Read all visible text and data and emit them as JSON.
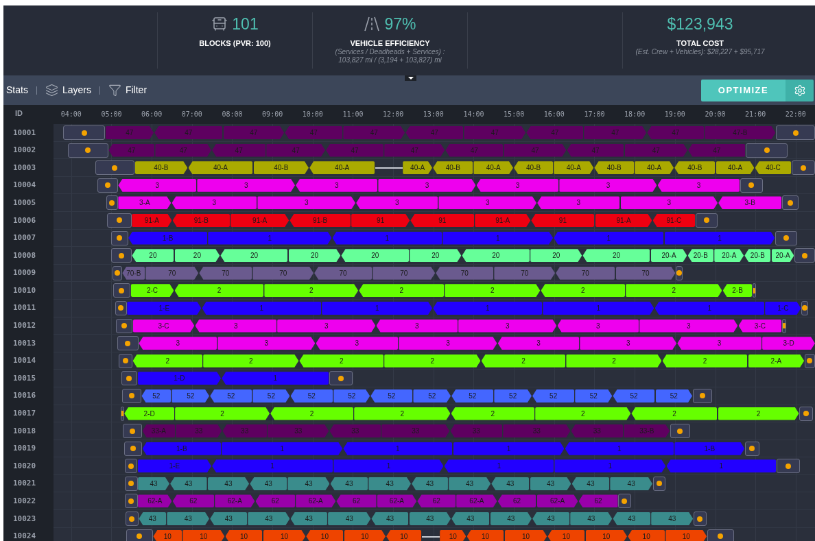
{
  "stats": [
    {
      "kind": "blank"
    },
    {
      "kind": "fleet",
      "value": "101",
      "label": "BLOCKS (PVR: 100)"
    },
    {
      "kind": "road",
      "value": "97%",
      "label": "VEHICLE EFFICIENCY",
      "notes": [
        "(Services / Deadheads + Services) :",
        "103,827 mi / (3,194 + 103,827) mi"
      ]
    },
    {
      "kind": "blank"
    },
    {
      "kind": "plain",
      "value": "$123,943",
      "label": "TOTAL COST",
      "notes": [
        "(Est. Crew + Vehicles): $28,227 + $95,717"
      ]
    }
  ],
  "toolbar": {
    "items": [
      {
        "kind": "text",
        "label": "Stats"
      },
      {
        "kind": "layers",
        "label": "Layers"
      },
      {
        "kind": "filter",
        "label": "Filter"
      }
    ],
    "primary_button": "OPTIMIZE"
  },
  "schedule": {
    "id_header": "ID",
    "times": [
      "04:00",
      "05:00",
      "06:00",
      "07:00",
      "08:00",
      "09:00",
      "10:00",
      "11:00",
      "12:00",
      "13:00",
      "14:00",
      "15:00",
      "16:00",
      "17:00",
      "18:00",
      "19:00",
      "20:00",
      "21:00",
      "22:00"
    ],
    "rows": [
      {
        "id": "10001",
        "color": "#5e0060",
        "trips": [
          {
            "label": "47",
            "kind": "right"
          },
          {
            "label": "47",
            "kind": "left"
          },
          {
            "label": "47",
            "kind": "right"
          },
          {
            "label": "47",
            "kind": "left"
          },
          {
            "label": "47",
            "kind": "right"
          },
          {
            "label": "47",
            "kind": "left"
          },
          {
            "label": "47",
            "kind": "right"
          },
          {
            "label": "47",
            "kind": "left"
          },
          {
            "label": "47",
            "kind": "right"
          },
          {
            "label": "47",
            "kind": "left"
          },
          {
            "label": "47-B",
            "kind": "right"
          }
        ]
      },
      {
        "id": "10002",
        "color": "#5e0060",
        "trips": [
          {
            "label": "47",
            "kind": "left"
          },
          {
            "label": "47",
            "kind": "right"
          },
          {
            "label": "47",
            "kind": "left"
          },
          {
            "label": "47",
            "kind": "right"
          },
          {
            "label": "47",
            "kind": "left"
          },
          {
            "label": "47",
            "kind": "right"
          },
          {
            "label": "47",
            "kind": "left"
          },
          {
            "label": "47",
            "kind": "right"
          },
          {
            "label": "47",
            "kind": "left"
          },
          {
            "label": "47",
            "kind": "right"
          },
          {
            "label": "47",
            "kind": "left"
          }
        ]
      },
      {
        "id": "10003",
        "color": "#aaaa00",
        "trips": [
          {
            "label": "40-B",
            "kind": "right"
          },
          {
            "label": "40-A",
            "kind": "left"
          },
          {
            "label": "40-B",
            "kind": "right"
          },
          {
            "label": "40-A",
            "kind": "left"
          },
          {
            "label": "40-A",
            "kind": "right"
          },
          {
            "label": "40-B",
            "kind": "left"
          },
          {
            "label": "40-A",
            "kind": "right"
          },
          {
            "label": "40-B",
            "kind": "left"
          },
          {
            "label": "40-A",
            "kind": "right"
          },
          {
            "label": "40-B",
            "kind": "left"
          },
          {
            "label": "40-A",
            "kind": "right"
          },
          {
            "label": "40-B",
            "kind": "left"
          },
          {
            "label": "40-A",
            "kind": "right"
          },
          {
            "label": "40-C",
            "kind": "left"
          }
        ]
      },
      {
        "id": "10004",
        "color": "#ee00ee",
        "trips": [
          {
            "label": "3",
            "kind": "left"
          },
          {
            "label": "3",
            "kind": "right"
          },
          {
            "label": "3",
            "kind": "left"
          },
          {
            "label": "3",
            "kind": "right"
          },
          {
            "label": "3",
            "kind": "left"
          },
          {
            "label": "3",
            "kind": "right"
          },
          {
            "label": "3",
            "kind": "left"
          }
        ]
      },
      {
        "id": "10005",
        "color": "#ee00ee",
        "trips": [
          {
            "label": "3-A",
            "kind": "right"
          },
          {
            "label": "3",
            "kind": "left"
          },
          {
            "label": "3",
            "kind": "right"
          },
          {
            "label": "3",
            "kind": "left"
          },
          {
            "label": "3",
            "kind": "right"
          },
          {
            "label": "3",
            "kind": "left"
          },
          {
            "label": "3",
            "kind": "right"
          },
          {
            "label": "3-B",
            "kind": "left"
          }
        ]
      },
      {
        "id": "10006",
        "color": "#ee0011",
        "trips": [
          {
            "label": "91-A",
            "kind": "right"
          },
          {
            "label": "91-B",
            "kind": "left"
          },
          {
            "label": "91-A",
            "kind": "right"
          },
          {
            "label": "91-B",
            "kind": "left"
          },
          {
            "label": "91",
            "kind": "right"
          },
          {
            "label": "91",
            "kind": "left"
          },
          {
            "label": "91-A",
            "kind": "right"
          },
          {
            "label": "91",
            "kind": "left"
          },
          {
            "label": "91-A",
            "kind": "right"
          },
          {
            "label": "91-C",
            "kind": "left"
          }
        ]
      },
      {
        "id": "10007",
        "color": "#2200ff",
        "trips": [
          {
            "label": "1-B",
            "kind": "left"
          },
          {
            "label": "1",
            "kind": "right"
          },
          {
            "label": "1",
            "kind": "left"
          },
          {
            "label": "1",
            "kind": "right"
          },
          {
            "label": "1",
            "kind": "left"
          },
          {
            "label": "1",
            "kind": "right"
          }
        ]
      },
      {
        "id": "10008",
        "color": "#66ff99",
        "trips": [
          {
            "label": "20",
            "kind": "left"
          },
          {
            "label": "20",
            "kind": "right"
          },
          {
            "label": "20",
            "kind": "left"
          },
          {
            "label": "20",
            "kind": "right"
          },
          {
            "label": "20",
            "kind": "left"
          },
          {
            "label": "20",
            "kind": "right"
          },
          {
            "label": "20",
            "kind": "left"
          },
          {
            "label": "20",
            "kind": "right"
          },
          {
            "label": "20",
            "kind": "left"
          },
          {
            "label": "20-A",
            "kind": "right"
          },
          {
            "label": "20-B",
            "kind": "left"
          },
          {
            "label": "20-A",
            "kind": "right"
          },
          {
            "label": "20-B",
            "kind": "left"
          },
          {
            "label": "20-A",
            "kind": "right"
          }
        ]
      },
      {
        "id": "10009",
        "color": "#6a5a8e",
        "trips": [
          {
            "label": "70-B",
            "kind": "left"
          },
          {
            "label": "70",
            "kind": "right"
          },
          {
            "label": "70",
            "kind": "left"
          },
          {
            "label": "70",
            "kind": "right"
          },
          {
            "label": "70",
            "kind": "left"
          },
          {
            "label": "70",
            "kind": "right"
          },
          {
            "label": "70",
            "kind": "left"
          },
          {
            "label": "70",
            "kind": "right"
          },
          {
            "label": "70",
            "kind": "left"
          },
          {
            "label": "70",
            "kind": "right"
          }
        ]
      },
      {
        "id": "10010",
        "color": "#66ff00",
        "trips": [
          {
            "label": "2-C",
            "kind": "right"
          },
          {
            "label": "2",
            "kind": "left"
          },
          {
            "label": "2",
            "kind": "right"
          },
          {
            "label": "2",
            "kind": "left"
          },
          {
            "label": "2",
            "kind": "right"
          },
          {
            "label": "2",
            "kind": "left"
          },
          {
            "label": "2",
            "kind": "right"
          },
          {
            "label": "2-B",
            "kind": "left"
          }
        ]
      },
      {
        "id": "10011",
        "color": "#2200ff",
        "trips": [
          {
            "label": "1-E",
            "kind": "right"
          },
          {
            "label": "1",
            "kind": "left"
          },
          {
            "label": "1",
            "kind": "right"
          },
          {
            "label": "1",
            "kind": "left"
          },
          {
            "label": "1",
            "kind": "right"
          },
          {
            "label": "1",
            "kind": "left"
          },
          {
            "label": "1-C",
            "kind": "right"
          }
        ]
      },
      {
        "id": "10012",
        "color": "#ee00ee",
        "trips": [
          {
            "label": "3-C",
            "kind": "right"
          },
          {
            "label": "3",
            "kind": "left"
          },
          {
            "label": "3",
            "kind": "right"
          },
          {
            "label": "3",
            "kind": "left"
          },
          {
            "label": "3",
            "kind": "right"
          },
          {
            "label": "3",
            "kind": "left"
          },
          {
            "label": "3",
            "kind": "right"
          },
          {
            "label": "3-C",
            "kind": "left"
          }
        ]
      },
      {
        "id": "10013",
        "color": "#ee00ee",
        "trips": [
          {
            "label": "3",
            "kind": "left"
          },
          {
            "label": "3",
            "kind": "right"
          },
          {
            "label": "3",
            "kind": "left"
          },
          {
            "label": "3",
            "kind": "right"
          },
          {
            "label": "3",
            "kind": "left"
          },
          {
            "label": "3",
            "kind": "right"
          },
          {
            "label": "3",
            "kind": "left"
          },
          {
            "label": "3-D",
            "kind": "right"
          }
        ]
      },
      {
        "id": "10014",
        "color": "#66ff00",
        "trips": [
          {
            "label": "2",
            "kind": "left"
          },
          {
            "label": "2",
            "kind": "right"
          },
          {
            "label": "2",
            "kind": "left"
          },
          {
            "label": "2",
            "kind": "right"
          },
          {
            "label": "2",
            "kind": "left"
          },
          {
            "label": "2",
            "kind": "right"
          },
          {
            "label": "2",
            "kind": "left"
          },
          {
            "label": "2-A",
            "kind": "right"
          }
        ]
      },
      {
        "id": "10015",
        "color": "#2200ff",
        "trips": [
          {
            "label": "1-D",
            "kind": "right"
          },
          {
            "label": "1",
            "kind": "left"
          }
        ]
      },
      {
        "id": "10016",
        "color": "#4466ff",
        "trips": [
          {
            "label": "52",
            "kind": "left"
          },
          {
            "label": "52",
            "kind": "right"
          },
          {
            "label": "52",
            "kind": "left"
          },
          {
            "label": "52",
            "kind": "right"
          },
          {
            "label": "52",
            "kind": "left"
          },
          {
            "label": "52",
            "kind": "right"
          },
          {
            "label": "52",
            "kind": "left"
          },
          {
            "label": "52",
            "kind": "right"
          },
          {
            "label": "52",
            "kind": "left"
          },
          {
            "label": "52",
            "kind": "right"
          },
          {
            "label": "52",
            "kind": "left"
          },
          {
            "label": "52",
            "kind": "right"
          },
          {
            "label": "52",
            "kind": "left"
          },
          {
            "label": "52",
            "kind": "right"
          }
        ]
      },
      {
        "id": "10017",
        "color": "#66ff00",
        "trips": [
          {
            "label": "2-D",
            "kind": "left"
          },
          {
            "label": "2",
            "kind": "right"
          },
          {
            "label": "2",
            "kind": "left"
          },
          {
            "label": "2",
            "kind": "right"
          },
          {
            "label": "2",
            "kind": "left"
          },
          {
            "label": "2",
            "kind": "right"
          },
          {
            "label": "2",
            "kind": "left"
          },
          {
            "label": "2",
            "kind": "right"
          }
        ]
      },
      {
        "id": "10018",
        "color": "#5e0060",
        "trips": [
          {
            "label": "33-A",
            "kind": "left"
          },
          {
            "label": "33",
            "kind": "right"
          },
          {
            "label": "33",
            "kind": "left"
          },
          {
            "label": "33",
            "kind": "right"
          },
          {
            "label": "33",
            "kind": "left"
          },
          {
            "label": "33",
            "kind": "right"
          },
          {
            "label": "33",
            "kind": "left"
          },
          {
            "label": "33",
            "kind": "right"
          },
          {
            "label": "33",
            "kind": "left"
          },
          {
            "label": "33-B",
            "kind": "right"
          }
        ]
      },
      {
        "id": "10019",
        "color": "#2200ff",
        "trips": [
          {
            "label": "1-B",
            "kind": "left"
          },
          {
            "label": "1",
            "kind": "right"
          },
          {
            "label": "1",
            "kind": "left"
          },
          {
            "label": "1",
            "kind": "right"
          },
          {
            "label": "1",
            "kind": "left"
          },
          {
            "label": "1-B",
            "kind": "right"
          }
        ]
      },
      {
        "id": "10020",
        "color": "#2200ff",
        "trips": [
          {
            "label": "1-E",
            "kind": "right"
          },
          {
            "label": "1",
            "kind": "left"
          },
          {
            "label": "1",
            "kind": "right"
          },
          {
            "label": "1",
            "kind": "left"
          },
          {
            "label": "1",
            "kind": "right"
          },
          {
            "label": "1",
            "kind": "left"
          }
        ]
      },
      {
        "id": "10021",
        "color": "#3a8c8c",
        "trips": [
          {
            "label": "43",
            "kind": "right"
          },
          {
            "label": "43",
            "kind": "left"
          },
          {
            "label": "43",
            "kind": "right"
          },
          {
            "label": "43",
            "kind": "left"
          },
          {
            "label": "43",
            "kind": "right"
          },
          {
            "label": "43",
            "kind": "left"
          },
          {
            "label": "43",
            "kind": "right"
          },
          {
            "label": "43",
            "kind": "left"
          },
          {
            "label": "43",
            "kind": "right"
          },
          {
            "label": "43",
            "kind": "left"
          },
          {
            "label": "43",
            "kind": "right"
          },
          {
            "label": "43",
            "kind": "left"
          },
          {
            "label": "43",
            "kind": "right"
          }
        ]
      },
      {
        "id": "10022",
        "color": "#9900aa",
        "trips": [
          {
            "label": "62-A",
            "kind": "right"
          },
          {
            "label": "62",
            "kind": "left"
          },
          {
            "label": "62-A",
            "kind": "right"
          },
          {
            "label": "62",
            "kind": "left"
          },
          {
            "label": "62-A",
            "kind": "right"
          },
          {
            "label": "62",
            "kind": "left"
          },
          {
            "label": "62-A",
            "kind": "right"
          },
          {
            "label": "62",
            "kind": "left"
          },
          {
            "label": "62-A",
            "kind": "right"
          },
          {
            "label": "62",
            "kind": "left"
          },
          {
            "label": "62-A",
            "kind": "right"
          },
          {
            "label": "62",
            "kind": "left"
          }
        ]
      },
      {
        "id": "10023",
        "color": "#3a8c8c",
        "trips": [
          {
            "label": "43",
            "kind": "left"
          },
          {
            "label": "43",
            "kind": "right"
          },
          {
            "label": "43",
            "kind": "left"
          },
          {
            "label": "43",
            "kind": "right"
          },
          {
            "label": "43",
            "kind": "left"
          },
          {
            "label": "43",
            "kind": "right"
          },
          {
            "label": "43",
            "kind": "left"
          },
          {
            "label": "43",
            "kind": "right"
          },
          {
            "label": "43",
            "kind": "left"
          },
          {
            "label": "43",
            "kind": "right"
          },
          {
            "label": "43",
            "kind": "left"
          },
          {
            "label": "43",
            "kind": "right"
          },
          {
            "label": "43",
            "kind": "left"
          },
          {
            "label": "43",
            "kind": "right"
          }
        ]
      },
      {
        "id": "10024",
        "color": "#ee4400",
        "trips": [
          {
            "label": "10",
            "kind": "left"
          },
          {
            "label": "10",
            "kind": "right"
          },
          {
            "label": "10",
            "kind": "left"
          },
          {
            "label": "10",
            "kind": "right"
          },
          {
            "label": "10",
            "kind": "left"
          },
          {
            "label": "10",
            "kind": "right"
          },
          {
            "label": "10",
            "kind": "left"
          },
          {
            "label": "10",
            "kind": "right"
          },
          {
            "label": "10",
            "kind": "left"
          },
          {
            "label": "10",
            "kind": "right"
          },
          {
            "label": "10",
            "kind": "left"
          },
          {
            "label": "10",
            "kind": "right"
          },
          {
            "label": "10",
            "kind": "left"
          },
          {
            "label": "10",
            "kind": "right"
          }
        ]
      }
    ]
  }
}
